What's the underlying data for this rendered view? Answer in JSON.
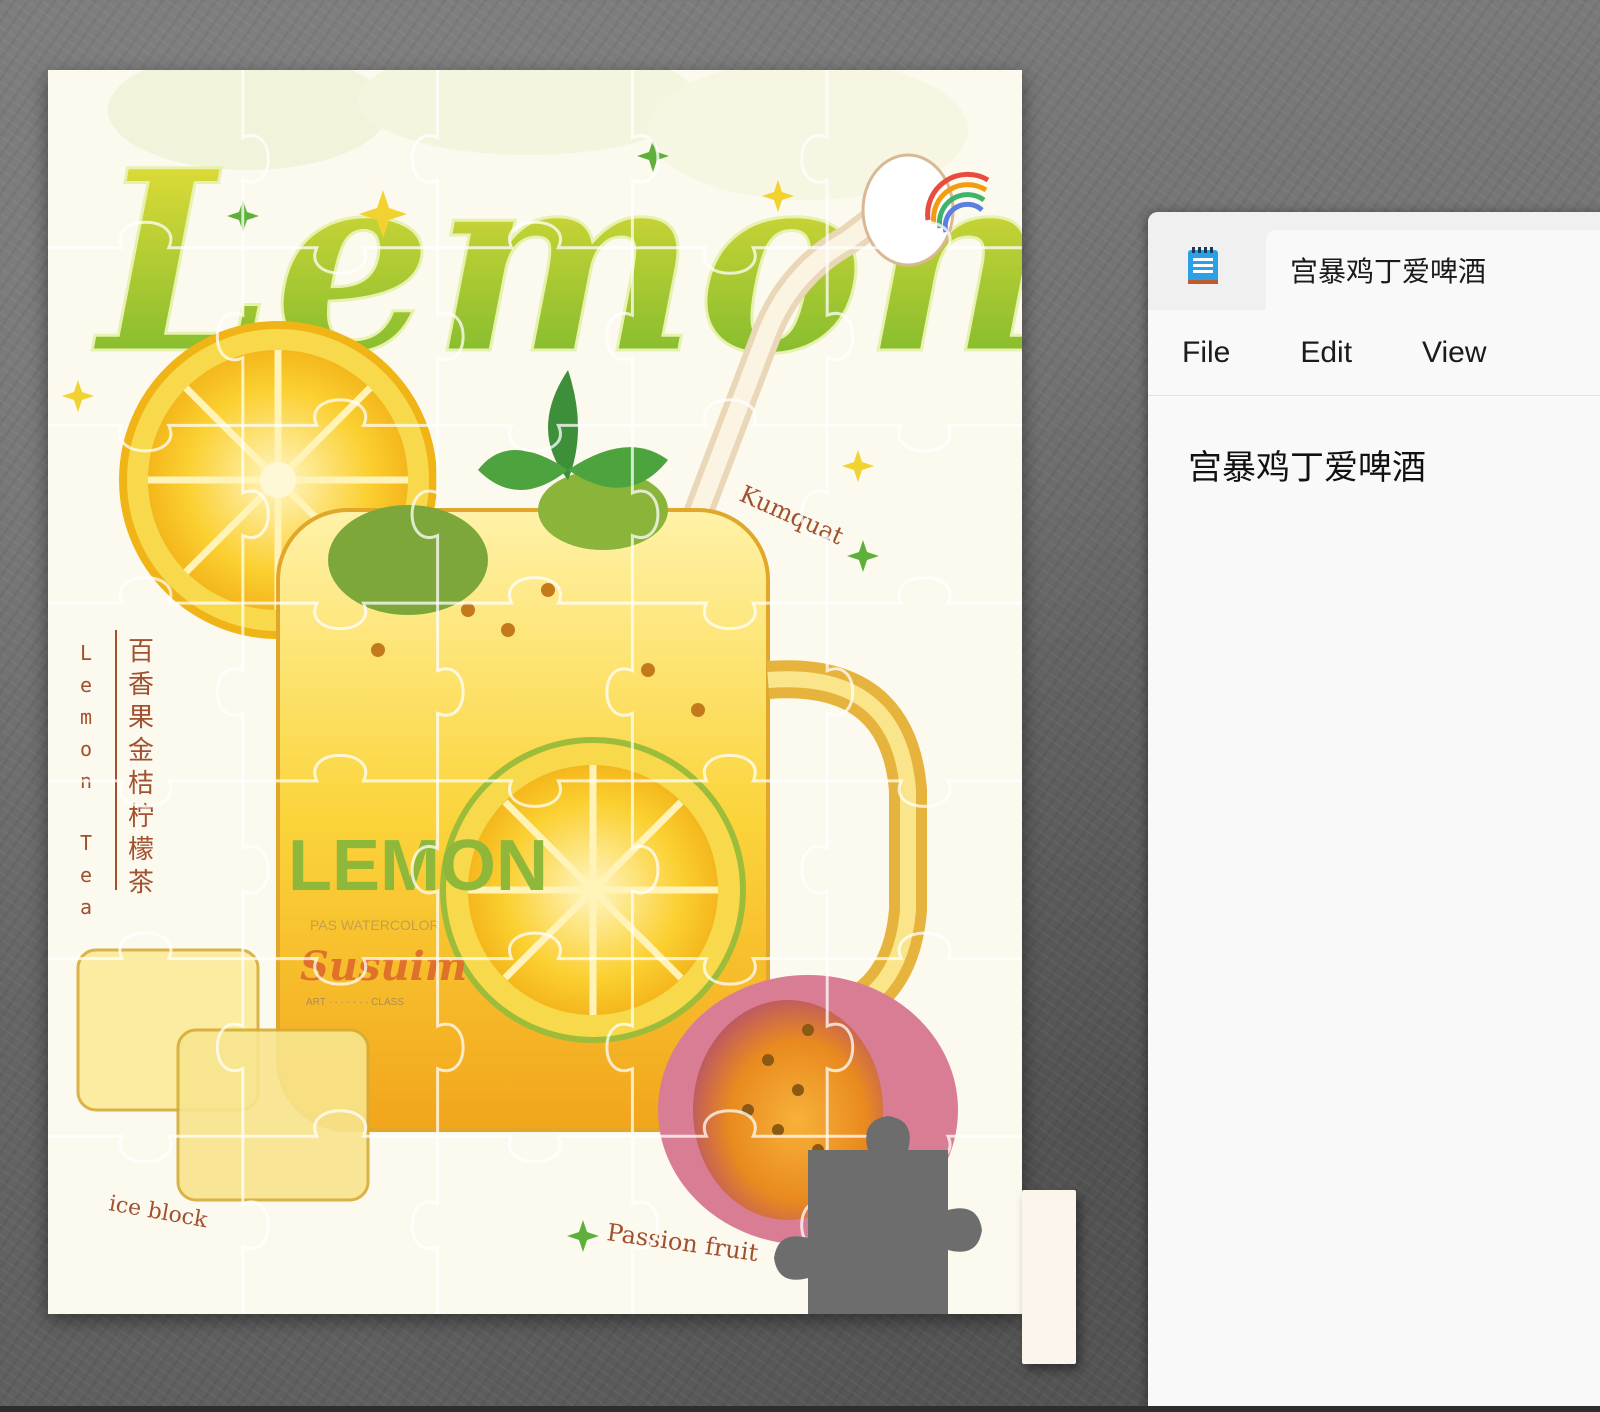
{
  "puzzle": {
    "title_script": "Lemon",
    "vertical_cn": [
      "百",
      "香",
      "果",
      "金",
      "桔",
      "柠",
      "檬",
      "茶"
    ],
    "vertical_en": [
      "L",
      "e",
      "m",
      "o",
      "n",
      "T",
      "e",
      "a"
    ],
    "mug_label": "LEMON",
    "mug_sub": "PAS WATERCOLOR",
    "mug_brand": "Susuim",
    "mug_tiny": "ART · · · · · · · CLASS",
    "label_kumquat": "Kumquat",
    "label_ice": "ice block",
    "label_passion": "Passion fruit",
    "colors": {
      "lemon": "#f7c81e",
      "lemon_light": "#ffe680",
      "green": "#7dbb2e",
      "brown_text": "#a2512f",
      "passion_skin": "#b8526a"
    }
  },
  "notepad": {
    "tab_title": "宫暴鸡丁爱啤酒",
    "menu": {
      "file": "File",
      "edit": "Edit",
      "view": "View"
    },
    "content": "宫暴鸡丁爱啤酒"
  }
}
